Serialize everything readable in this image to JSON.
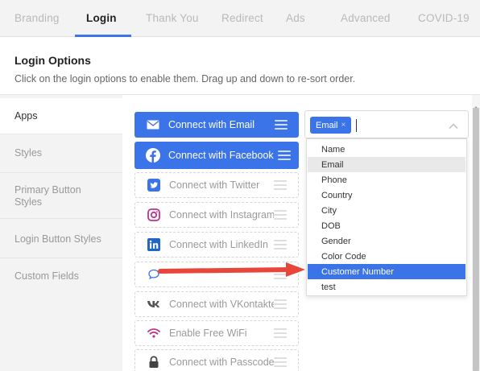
{
  "tabs": [
    {
      "label": "Branding"
    },
    {
      "label": "Login"
    },
    {
      "label": "Thank You"
    },
    {
      "label": "Redirect"
    },
    {
      "label": "Ads"
    },
    {
      "label": "Advanced"
    },
    {
      "label": "COVID-19"
    }
  ],
  "active_tab": "Login",
  "section": {
    "title": "Login Options",
    "description": "Click on the login options to enable them. Drag up and down to re-sort order."
  },
  "sidebar": {
    "items": [
      {
        "label": "Apps"
      },
      {
        "label": "Styles"
      },
      {
        "label": "Primary Button Styles"
      },
      {
        "label": "Login Button Styles"
      },
      {
        "label": "Custom Fields"
      }
    ]
  },
  "login_options": [
    {
      "label": "Connect with Email",
      "icon": "envelope-icon",
      "enabled": true
    },
    {
      "label": "Connect with Facebook",
      "icon": "facebook-icon",
      "enabled": true
    },
    {
      "label": "Connect with Twitter",
      "icon": "twitter-icon",
      "enabled": false
    },
    {
      "label": "Connect with Instagram",
      "icon": "instagram-icon",
      "enabled": false
    },
    {
      "label": "Connect with LinkedIn",
      "icon": "linkedin-icon",
      "enabled": false
    },
    {
      "label": "",
      "icon": "chat-bubble-icon",
      "enabled": false
    },
    {
      "label": "Connect with VKontakte",
      "icon": "vk-icon",
      "enabled": false
    },
    {
      "label": "Enable Free WiFi",
      "icon": "wifi-icon",
      "enabled": false
    },
    {
      "label": "Connect with Passcode",
      "icon": "lock-icon",
      "enabled": false
    }
  ],
  "email_fields_select": {
    "selected_tags": [
      "Email"
    ],
    "tag_remove": "×",
    "options": [
      "Name",
      "Email",
      "Phone",
      "Country",
      "City",
      "DOB",
      "Gender",
      "Color Code",
      "Customer Number",
      "test"
    ],
    "highlighted_option": "Customer Number"
  },
  "colors": {
    "accent": "#3b73e8",
    "annotation_arrow": "#e8463a",
    "tab_bar_bg": "#f3f3f3"
  }
}
